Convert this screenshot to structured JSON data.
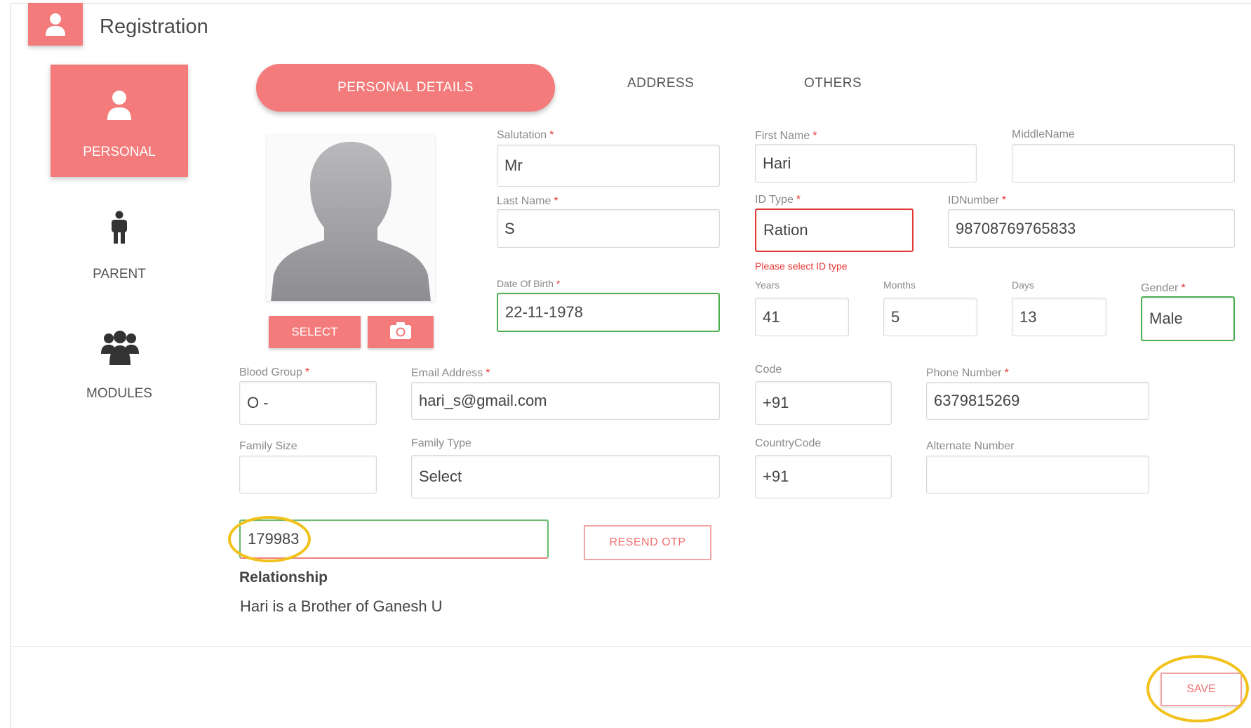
{
  "header": {
    "title": "Registration",
    "icon": "user-icon"
  },
  "sidebar": {
    "items": [
      {
        "label": "PERSONAL",
        "icon": "user-icon",
        "active": true
      },
      {
        "label": "PARENT",
        "icon": "person-icon",
        "active": false
      },
      {
        "label": "MODULES",
        "icon": "users-group-icon",
        "active": false
      }
    ]
  },
  "tabs": [
    {
      "label": "PERSONAL DETAILS",
      "active": true
    },
    {
      "label": "ADDRESS",
      "active": false
    },
    {
      "label": "OTHERS",
      "active": false
    }
  ],
  "photo": {
    "select_label": "SELECT",
    "camera_icon": "camera-icon"
  },
  "form": {
    "salutation": {
      "label": "Salutation",
      "required": "*",
      "value": "Mr"
    },
    "first_name": {
      "label": "First Name",
      "required": "*",
      "value": "Hari"
    },
    "middle_name": {
      "label": "MiddleName",
      "value": ""
    },
    "last_name": {
      "label": "Last Name",
      "required": "*",
      "value": "S"
    },
    "id_type": {
      "label": "ID Type",
      "required": "*",
      "value": "Ration",
      "error": "Please select ID type"
    },
    "id_number": {
      "label": "IDNumber",
      "required": "*",
      "value": "98708769765833"
    },
    "dob": {
      "label": "Date Of Birth",
      "required": "*",
      "value": "22-11-1978"
    },
    "years": {
      "label": "Years",
      "value": "41"
    },
    "months": {
      "label": "Months",
      "value": "5"
    },
    "days": {
      "label": "Days",
      "value": "13"
    },
    "gender": {
      "label": "Gender",
      "required": "*",
      "value": "Male"
    },
    "blood_group": {
      "label": "Blood Group",
      "required": "*",
      "value": "O -"
    },
    "email": {
      "label": "Email Address",
      "required": "*",
      "value": "hari_s@gmail.com"
    },
    "code": {
      "label": "Code",
      "value": "+91"
    },
    "phone": {
      "label": "Phone Number",
      "required": "*",
      "value": "6379815269"
    },
    "family_size": {
      "label": "Family Size",
      "value": ""
    },
    "family_type": {
      "label": "Family Type",
      "value": "Select"
    },
    "country_code": {
      "label": "CountryCode",
      "value": "+91"
    },
    "alternate_number": {
      "label": "Alternate Number",
      "value": ""
    },
    "otp": {
      "value": "179983"
    }
  },
  "resend_label": "RESEND OTP",
  "relationship": {
    "title": "Relationship",
    "text": "Hari is a Brother of Ganesh U"
  },
  "save_label": "SAVE",
  "colors": {
    "accent": "#f47b7b",
    "error": "#e53935",
    "valid": "#4caf50",
    "highlight": "#f2c21b"
  }
}
